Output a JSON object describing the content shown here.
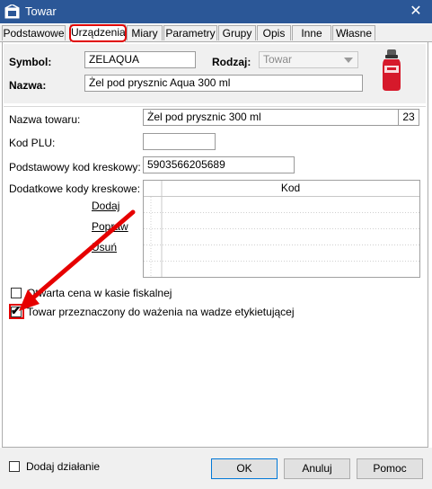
{
  "window": {
    "title": "Towar",
    "close_glyph": "✕"
  },
  "tabs": [
    {
      "label": "Podstawowe"
    },
    {
      "label": "Urządzenia"
    },
    {
      "label": "Miary"
    },
    {
      "label": "Parametry"
    },
    {
      "label": "Grupy"
    },
    {
      "label": "Opis"
    },
    {
      "label": "Inne"
    },
    {
      "label": "Własne"
    }
  ],
  "active_tab": "Urządzenia",
  "header": {
    "symbol_label": "Symbol:",
    "symbol_value": "ZELAQUA",
    "rodzaj_label": "Rodzaj:",
    "rodzaj_value": "Towar",
    "nazwa_label": "Nazwa:",
    "nazwa_value": "Żel pod prysznic Aqua 300 ml"
  },
  "form": {
    "nazwa_towaru_label": "Nazwa towaru:",
    "nazwa_towaru_value": "Żel pod prysznic 300 ml",
    "nazwa_towaru_count": "23",
    "kod_plu_label": "Kod PLU:",
    "kod_plu_value": "",
    "kod_kreskowy_label": "Podstawowy kod kreskowy:",
    "kod_kreskowy_value": "5903566205689",
    "dodatkowe_label": "Dodatkowe kody kreskowe:",
    "grid_header": "Kod",
    "actions": {
      "add": "Dodaj",
      "edit": "Popraw",
      "remove": "Usuń"
    }
  },
  "checkboxes": {
    "otwarta_cena": {
      "label": "Otwarta cena w kasie fiskalnej",
      "checked": false
    },
    "ważenie": {
      "label": "Towar przeznaczony do ważenia na wadze etykietującej",
      "checked": true
    }
  },
  "footer": {
    "dodaj_dzialanie": {
      "label": "Dodaj działanie",
      "checked": false
    },
    "ok": "OK",
    "anuluj": "Anuluj",
    "pomoc": "Pomoc"
  },
  "colors": {
    "titlebar": "#2b5797",
    "highlight": "#e00000",
    "arrow": "#e60000",
    "product": "#d6192b"
  },
  "icons": [
    "app-icon",
    "close-icon",
    "dropdown-arrow-icon",
    "product-image",
    "annotation-arrow"
  ]
}
